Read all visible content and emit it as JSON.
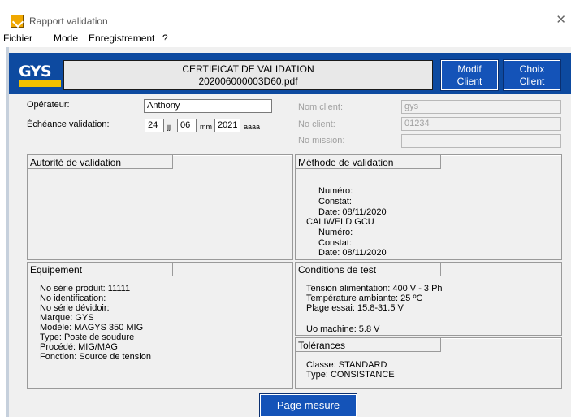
{
  "window": {
    "title": "Rapport validation",
    "close": "✕"
  },
  "menu": [
    "Fichier",
    "Mode",
    "Enregistrement",
    "?"
  ],
  "header": {
    "logo": "GYS",
    "cert_title": "CERTIFICAT DE VALIDATION",
    "cert_file": "202006000003D60.pdf",
    "modif_btn": [
      "Modif",
      "Client"
    ],
    "choix_btn": [
      "Choix",
      "Client"
    ]
  },
  "form": {
    "operateur_label": "Opérateur:",
    "operateur_value": "Anthony",
    "echeance_label": "Échéance validation:",
    "day": "24",
    "day_unit": "jj",
    "month": "06",
    "month_unit": "mm",
    "year": "2021",
    "year_unit": "aaaa",
    "nom_client_label": "Nom client:",
    "nom_client_value": "gys",
    "no_client_label": "No client:",
    "no_client_value": "01234",
    "no_mission_label": "No mission:",
    "no_mission_value": ""
  },
  "panels": {
    "autorite": {
      "title": "Autorité de validation"
    },
    "methode": {
      "title": "Méthode de validation",
      "lines": [
        "Numéro:",
        "Constat:",
        "Date: 08/11/2020",
        "CALIWELD GCU",
        "Numéro:",
        "Constat:",
        "Date: 08/11/2020"
      ]
    },
    "equipement": {
      "title": "Equipement",
      "lines": [
        "No série produit: 11111",
        "No identification:",
        "No série dévidoir:",
        "Marque: GYS",
        "Modèle: MAGYS 350 MIG",
        "Type: Poste de soudure",
        "Procédé: MIG/MAG",
        "Fonction: Source de tension"
      ]
    },
    "conditions": {
      "title": "Conditions de test",
      "lines": [
        "Tension alimentation: 400 V - 3 Ph",
        "Température ambiante: 25 ºC",
        "Plage essai: 15.8-31.5 V",
        "Uo machine:  5.8 V"
      ]
    },
    "tolerances": {
      "title": "Tolérances",
      "lines": [
        "Classe: STANDARD",
        "Type: CONSISTANCE"
      ]
    }
  },
  "footer": {
    "page_btn": "Page mesure"
  }
}
